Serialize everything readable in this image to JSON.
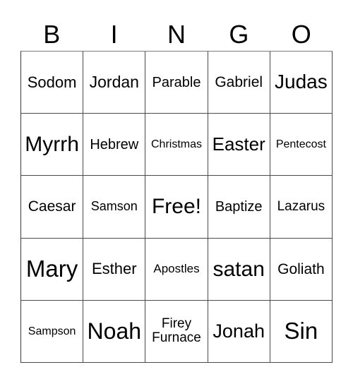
{
  "header": {
    "letters": [
      "B",
      "I",
      "N",
      "G",
      "O"
    ]
  },
  "board": {
    "rows": [
      [
        "Sodom",
        "Jordan",
        "Parable",
        "Gabriel",
        "Judas"
      ],
      [
        "Myrrh",
        "Hebrew",
        "Christmas",
        "Easter",
        "Pentecost"
      ],
      [
        "Caesar",
        "Samson",
        "Free!",
        "Baptize",
        "Lazarus"
      ],
      [
        "Mary",
        "Esther",
        "Apostles",
        "satan",
        "Goliath"
      ],
      [
        "Sampson",
        "Noah",
        "Firey Furnace",
        "Jonah",
        "Sin"
      ]
    ],
    "free_space": "Free!"
  }
}
